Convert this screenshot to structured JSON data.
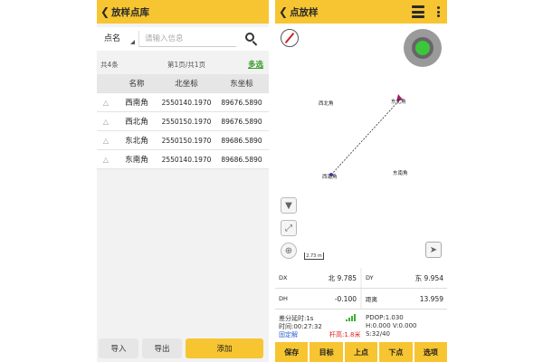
{
  "library": {
    "title": "放样点库",
    "search": {
      "field_label": "点名",
      "placeholder": "请输入信息"
    },
    "summary": {
      "count": "共4条",
      "page": "第1页/共1页",
      "multi_select": "多选"
    },
    "table": {
      "headers": [
        "名称",
        "北坐标",
        "东坐标"
      ],
      "rows": [
        {
          "name": "西南角",
          "north": "2550140.1970",
          "east": "89676.5890"
        },
        {
          "name": "西北角",
          "north": "2550150.1970",
          "east": "89676.5890"
        },
        {
          "name": "东北角",
          "north": "2550150.1970",
          "east": "89686.5890"
        },
        {
          "name": "东南角",
          "north": "2550140.1970",
          "east": "89686.5890"
        }
      ]
    },
    "buttons": {
      "import": "导入",
      "export": "导出",
      "add": "添加"
    }
  },
  "stakeout": {
    "title": "点放样",
    "map_labels": {
      "nw": "西北角",
      "ne": "东北角",
      "sw": "西南角",
      "se": "东南角"
    },
    "scale": "2.73 m",
    "stats": {
      "dx_label": "DX",
      "dx_value": "北 9.785",
      "dy_label": "DY",
      "dy_value": "东 9.954",
      "dh_label": "DH",
      "dh_value": "-0.100",
      "dist_label": "距离",
      "dist_value": "13.959"
    },
    "info": {
      "diff_delay": "差分延时:1s",
      "time": "时间:00:27:32",
      "fix": "固定解",
      "pdop": "PDOP:1.030",
      "hv": "H:0.000  V:0.000",
      "height": "杆高:1.8米",
      "sats": "S:32/40"
    },
    "actions": [
      "保存",
      "目标",
      "上点",
      "下点",
      "选项"
    ]
  },
  "colors": {
    "accent": "#f7c531",
    "fix_status": "#2a5bd8",
    "height_status": "#d22222",
    "multi_select": "#3a9b2c"
  }
}
